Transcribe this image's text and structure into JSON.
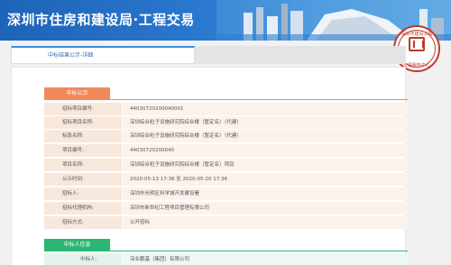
{
  "header": {
    "title": "深圳市住房和建设局·工程交易"
  },
  "seal": {
    "text_top": "深圳市建设工程",
    "text_bottom": "交易服务中心"
  },
  "tab": {
    "label": "中标结果公示-详细"
  },
  "bid_announcement": {
    "section_title": "中标公示",
    "rows": [
      {
        "label": "招标项目编号:",
        "value": "44030720200040001"
      },
      {
        "label": "招标项目名称:",
        "value": "深圳综合粒子设施研究院综合楼（暂定名）（代建）"
      },
      {
        "label": "标段名称:",
        "value": "深圳综合粒子设施研究院综合楼（暂定名）（代建）"
      },
      {
        "label": "项目编号:",
        "value": "44030720200040"
      },
      {
        "label": "项目名称:",
        "value": "深圳综合粒子设施研究院综合楼（暂定名）项目"
      },
      {
        "label": "公示时间:",
        "value": "2020-05-13 17:36 至 2020-05-20 17:36"
      },
      {
        "label": "招标人:",
        "value": "深圳市光明区科学城开发建设署"
      },
      {
        "label": "招标代理机构:",
        "value": "深圳市新世纪工程项目管理有限公司"
      },
      {
        "label": "招标方式:",
        "value": "公开招标"
      }
    ]
  },
  "winner": {
    "section_title": "中标人信息",
    "label": "中标人:",
    "value": "深业鹏基（集团）有限公司"
  }
}
